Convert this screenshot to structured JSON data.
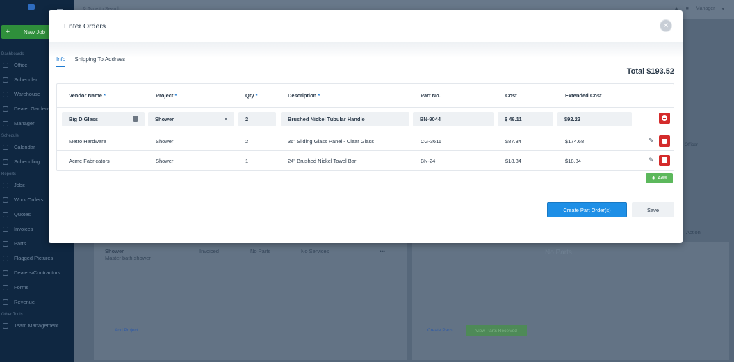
{
  "app": {
    "new_job_label": "New Job",
    "search_placeholder": "Type to Search",
    "user_label": "Manager",
    "sidebar": [
      {
        "type": "section",
        "label": "Dashboards"
      },
      {
        "type": "item",
        "label": "Office"
      },
      {
        "type": "item",
        "label": "Scheduler"
      },
      {
        "type": "item",
        "label": "Warehouse"
      },
      {
        "type": "item",
        "label": "Dealer Gardens"
      },
      {
        "type": "item",
        "label": "Manager"
      },
      {
        "type": "section",
        "label": "Schedule"
      },
      {
        "type": "item",
        "label": "Calendar"
      },
      {
        "type": "item",
        "label": "Scheduling"
      },
      {
        "type": "section",
        "label": "Reports"
      },
      {
        "type": "item",
        "label": "Jobs"
      },
      {
        "type": "item",
        "label": "Work Orders"
      },
      {
        "type": "item",
        "label": "Quotes"
      },
      {
        "type": "item",
        "label": "Invoices"
      },
      {
        "type": "item",
        "label": "Parts"
      },
      {
        "type": "item",
        "label": "Flagged Pictures"
      },
      {
        "type": "item",
        "label": "Dealers/Contractors"
      },
      {
        "type": "item",
        "label": "Forms"
      },
      {
        "type": "item",
        "label": "Revenue"
      },
      {
        "type": "section",
        "label": "Other Tools"
      },
      {
        "type": "item",
        "label": "Team Management"
      }
    ],
    "background": {
      "project_name": "Shower",
      "project_desc": "Master bath shower",
      "status": "Invoiced",
      "parts": "No Parts",
      "services": "No Services",
      "more": "•••",
      "no_parts": "No Parts",
      "add_project": "Add Project",
      "create_parts": "Create Parts",
      "view_parts": "View Parts Received",
      "action": "Action",
      "officer": "Officer"
    }
  },
  "modal": {
    "title": "Enter Orders",
    "close_icon": "✕",
    "tabs": [
      {
        "label": "Info",
        "active": true
      },
      {
        "label": "Shipping To Address",
        "active": false
      }
    ],
    "total_label": "Total $193.52",
    "columns": {
      "vendor": "Vendor Name",
      "project": "Project",
      "qty": "Qty",
      "description": "Description",
      "part_no": "Part No.",
      "cost": "Cost",
      "extended_cost": "Extended Cost",
      "required_mark": "*"
    },
    "edit_row": {
      "vendor": "Big D Glass",
      "project": "Shower",
      "qty": "2",
      "description": "Brushed Nickel Tubular Handle",
      "part_no": "BN-9044",
      "cost": "$ 46.11",
      "extended_cost": "$92.22"
    },
    "rows": [
      {
        "vendor": "Metro Hardware",
        "project": "Shower",
        "qty": "2",
        "description": "36\" Sliding Glass Panel - Clear Glass",
        "part_no": "CG-3611",
        "cost": "$87.34",
        "extended_cost": "$174.68"
      },
      {
        "vendor": "Acme Fabricators",
        "project": "Shower",
        "qty": "1",
        "description": "24\" Brushed Nickel Towel Bar",
        "part_no": "BN-24",
        "cost": "$18.84",
        "extended_cost": "$18.84"
      }
    ],
    "add_label": "Add",
    "add_icon": "+",
    "pencil_icon": "✎",
    "create_label": "Create Part Order(s)",
    "save_label": "Save"
  }
}
